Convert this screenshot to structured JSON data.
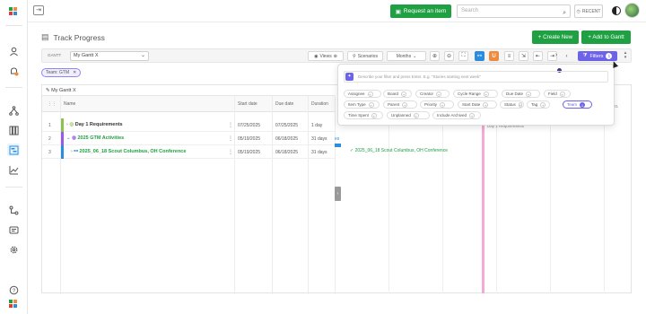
{
  "colors": {
    "brand_green": "#1ea043",
    "filter_purple": "#6c63e8",
    "today_line": "#f4a9d6",
    "section_purple": "#9b59e8",
    "task_blue": "#2a8ddf"
  },
  "sidebar": {
    "icons": [
      "logo-icon",
      "user-icon",
      "bell-icon",
      "hierarchy-icon",
      "columns-icon",
      "gantt-icon",
      "chart-icon",
      "workflow-icon",
      "message-icon",
      "settings-icon",
      "help-icon",
      "app-logo-icon"
    ]
  },
  "topbar": {
    "request_button": "Request an item",
    "search_placeholder": "Search",
    "recent_label": "RECENT"
  },
  "page": {
    "title": "Track Progress",
    "create_new": "+ Create New",
    "add_to_gantt": "+ Add to Gantt"
  },
  "toolbar": {
    "gantt_label": "GANTT",
    "gantt_select": "My Gantt X",
    "views": "Views",
    "scenarios": "Scenarios",
    "scale": "Months",
    "filters": "Filters",
    "filter_count": "1"
  },
  "active_filter_chip": "Team: GTM",
  "grid": {
    "title": "My Gantt X",
    "columns": {
      "name": "Name",
      "start": "Start date",
      "due": "Due date",
      "duration": "Duration"
    },
    "rows": [
      {
        "num": "1",
        "name": "Day 1 Requirements",
        "start": "07/25/2025",
        "due": "07/25/2025",
        "duration": "1 day",
        "color": "#8bc34a"
      },
      {
        "num": "2",
        "name": "2025 GTM Activities",
        "start": "05/19/2025",
        "due": "06/18/2025",
        "duration": "31 days",
        "color": "#9b59e8"
      },
      {
        "num": "3",
        "name": "2025_06_18 Scout Columbus, OH Conference",
        "start": "05/19/2025",
        "due": "06/18/2025",
        "duration": "31 days",
        "color": "#2a8ddf"
      }
    ]
  },
  "chart": {
    "task_label": "2025_06_18 Scout Columbus, OH Conference",
    "milestone_label": "Day 1 Requirements",
    "header_tail": "21",
    "es_label": "es"
  },
  "filter_popup": {
    "placeholder": "Describe your filter and press Enter. E.g. \"Stories starting next week\"",
    "chips": [
      "Assignee",
      "Board",
      "Creator",
      "Cycle Range",
      "Due Date",
      "Field",
      "Item Type",
      "Parent",
      "Priority",
      "Start Date",
      "Status",
      "Tag",
      "Team",
      "Time Spent",
      "Unplanned",
      "Include Archived"
    ],
    "team_count": "1"
  }
}
